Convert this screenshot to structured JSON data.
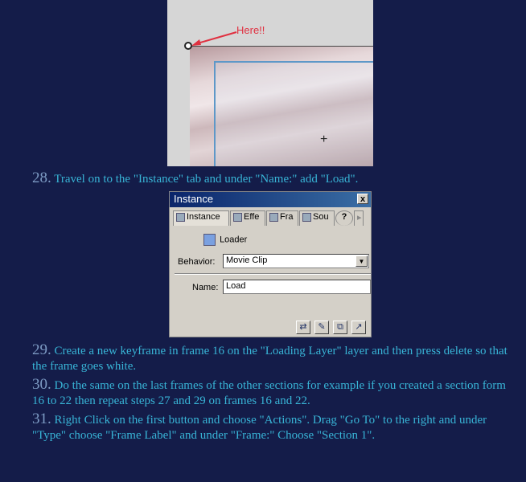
{
  "screenshot": {
    "annotation": "Here!!"
  },
  "steps": [
    {
      "num": "28.",
      "text": " Travel on to the \"Instance\" tab and under \"Name:\" add \"Load\"."
    },
    {
      "num": "29.",
      "text": " Create a new keyframe in frame 16 on the \"Loading Layer\" layer and then press delete so that the frame goes white."
    },
    {
      "num": "30.",
      "text": " Do the same on the last frames of the other sections for example if you created a section form 16 to 22 then repeat steps 27 and 29 on frames 16 and 22."
    },
    {
      "num": "31.",
      "text": " Right Click on the first button and choose \"Actions\". Drag \"Go To\" to the right and under \"Type\" choose \"Frame Label\" and under \"Frame:\" Choose \"Section 1\"."
    }
  ],
  "panel": {
    "title": "Instance",
    "close": "x",
    "tabs": [
      "Instance",
      "Effe",
      "Fra",
      "Sou"
    ],
    "help": "?",
    "arrow": "▸",
    "symbol_name": "Loader",
    "behavior_label": "Behavior:",
    "behavior_value": "Movie Clip",
    "name_label": "Name:",
    "name_value": "Load",
    "icons": [
      "swap-symbol-icon",
      "edit-symbol-icon",
      "duplicate-symbol-icon",
      "edit-in-place-icon"
    ]
  },
  "colors": {
    "background": "#141c49",
    "text": "#38b4d6",
    "step_number": "#7d9bc4",
    "annotation": "#e03040"
  }
}
